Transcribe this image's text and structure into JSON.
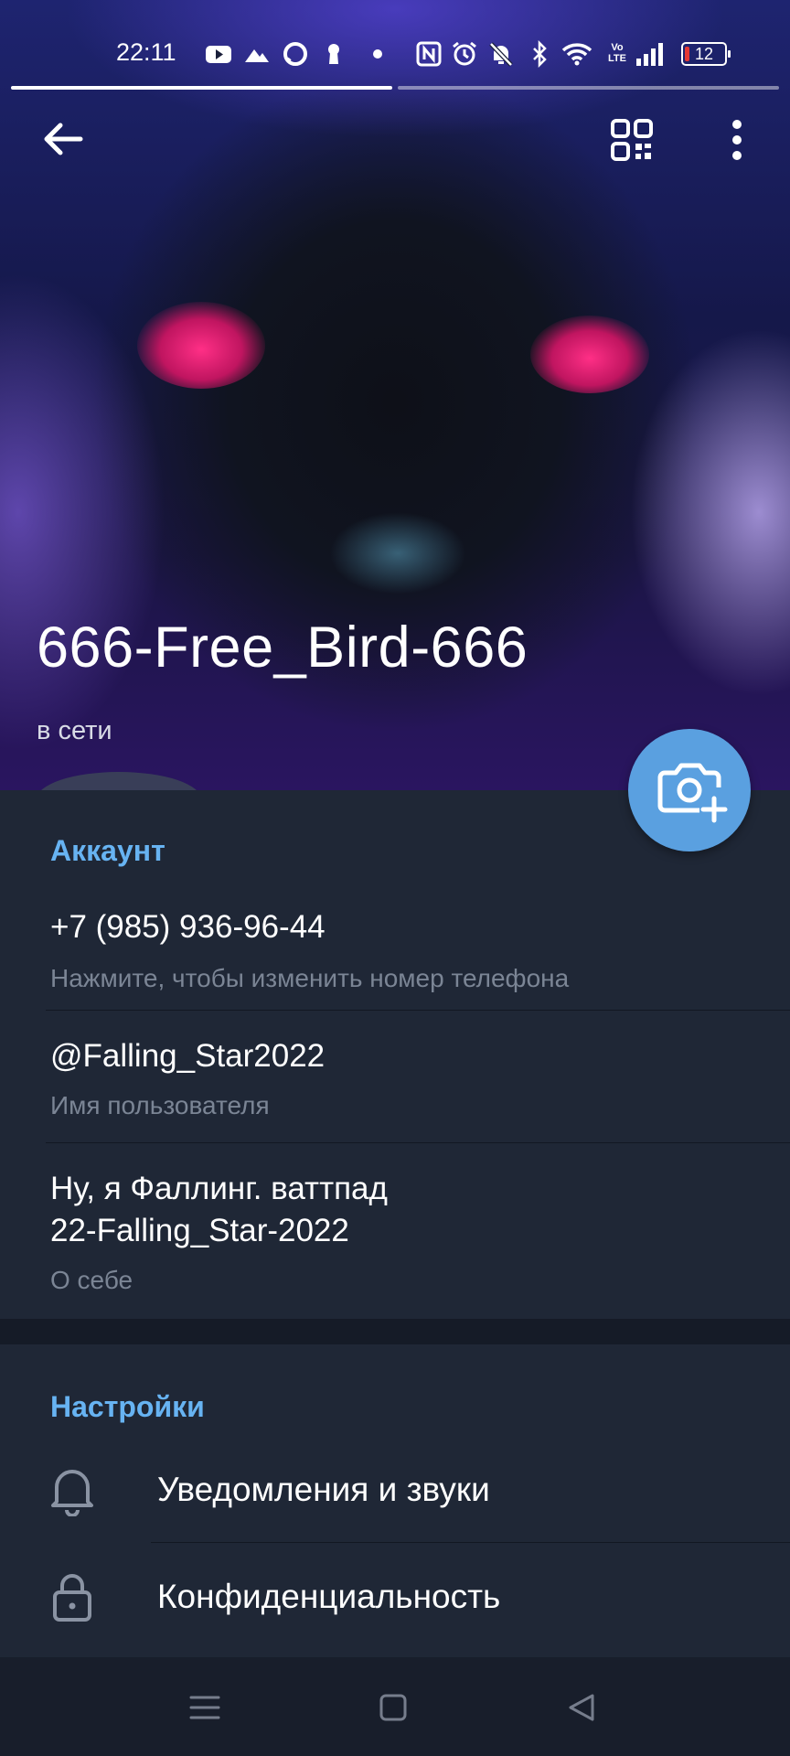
{
  "status_bar": {
    "time": "22:11",
    "network": "Vo LTE",
    "battery_level": "12",
    "notification_icons": [
      "youtube-icon",
      "mountain-icon",
      "chat-icon",
      "keyhole-icon",
      "dot-icon"
    ],
    "system_icons": [
      "nfc-icon",
      "alarm-icon",
      "mute-icon",
      "bluetooth-icon",
      "wifi-icon",
      "signal-icon",
      "battery-icon"
    ]
  },
  "header": {
    "back_icon": "arrow-left-icon",
    "qr_icon": "qr-code-icon",
    "menu_icon": "more-vert-icon"
  },
  "profile": {
    "name": "666-Free_Bird-666",
    "status": "в сети",
    "photo_button_icon": "camera-add-icon"
  },
  "account": {
    "title": "Аккаунт",
    "phone": "+7 (985) 936-96-44",
    "phone_hint": "Нажмите, чтобы изменить номер телефона",
    "username": "@Falling_Star2022",
    "username_hint": "Имя пользователя",
    "bio_line1": "Ну, я Фаллинг. ваттпад",
    "bio_line2": "22-Falling_Star-2022",
    "bio_hint": "О себе"
  },
  "settings": {
    "title": "Настройки",
    "items": [
      {
        "label": "Уведомления и звуки",
        "icon": "bell-icon"
      },
      {
        "label": "Конфиденциальность",
        "icon": "lock-icon"
      }
    ]
  },
  "navigation": {
    "icons": [
      "menu-icon",
      "home-icon",
      "back-triangle-icon"
    ]
  },
  "colors": {
    "accent": "#67b3f2",
    "fab": "#5aa0e0",
    "background": "#1f2736",
    "battery_low": "#e53935"
  }
}
